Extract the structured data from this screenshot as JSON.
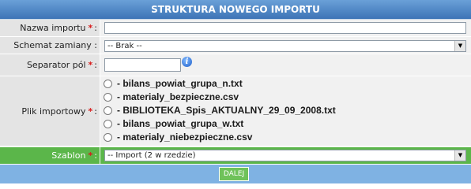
{
  "header": {
    "title": "STRUKTURA NOWEGO IMPORTU"
  },
  "form": {
    "name_label": "Nazwa importu",
    "scheme_label": "Schemat zamiany :",
    "scheme_value": "-- Brak --",
    "separator_label": "Separator pól",
    "file_label": "Plik importowy",
    "template_label": "Szablon",
    "template_value": "-- Import (2 w rzedzie)",
    "required_mark": "*",
    "colon": ":",
    "info_icon_glyph": "i",
    "files": [
      "- bilans_powiat_grupa_n.txt",
      "- materialy_bezpieczne.csv",
      "- BIBLIOTEKA_Spis_AKTUALNY_29_09_2008.txt",
      "- bilans_powiat_grupa_w.txt",
      "- materialy_niebezpieczne.csv"
    ],
    "select_arrow": "▼"
  },
  "footer": {
    "next_label": "DALEJ"
  },
  "colors": {
    "header": "#3d74b6",
    "label_bg": "#e4e4e4",
    "green": "#5bb64a",
    "required": "#d81c1c"
  }
}
